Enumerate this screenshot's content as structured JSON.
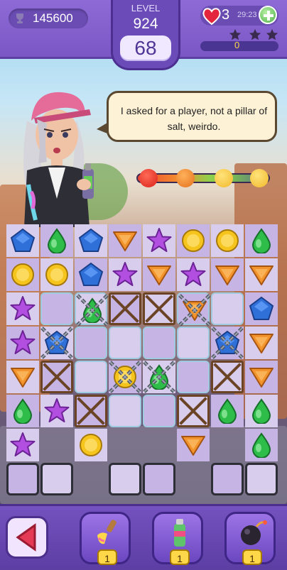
{
  "header": {
    "score": "145600",
    "level_label": "LEVEL",
    "level_number": "924",
    "moves_left": "68",
    "lives": "3",
    "lives_timer": "29:23",
    "star_progress": "0",
    "stars_earned": 0,
    "stars_total": 3
  },
  "character": {
    "speech": "I asked for a player, not a pillar of salt, weirdo.",
    "mood_faces": [
      "angry-face-icon",
      "annoyed-face-icon",
      "neutral-face-icon",
      "happy-face-icon"
    ]
  },
  "board": {
    "rows": [
      [
        "blue-pentagon",
        "green-drop",
        "blue-pentagon",
        "orange-triangle",
        "purple-star",
        "yellow-circle",
        "yellow-circle",
        "green-drop"
      ],
      [
        "yellow-circle",
        "yellow-circle",
        "blue-pentagon",
        "purple-star",
        "orange-triangle",
        "purple-star",
        "orange-triangle",
        "orange-triangle"
      ],
      [
        "purple-star",
        "ice",
        "chained-green-drop-ice",
        "crate",
        "crate",
        "chained-orange-triangle-ice",
        "ice",
        "blue-pentagon"
      ],
      [
        "purple-star",
        "chained-blue-pentagon",
        "ice",
        "ice",
        "ice",
        "ice",
        "chained-blue-pentagon",
        "orange-triangle"
      ],
      [
        "orange-triangle",
        "crate",
        "ice",
        "chained-yellow-circle",
        "chained-green-drop",
        "ice",
        "crate",
        "orange-triangle"
      ],
      [
        "green-drop",
        "purple-star",
        "crate",
        "ice",
        "ice",
        "crate",
        "green-drop",
        "green-drop"
      ],
      [
        "purple-star",
        "empty",
        "yellow-circle",
        "empty",
        "empty",
        "orange-triangle",
        "empty",
        "green-drop"
      ],
      [
        "grate",
        "grate",
        "empty",
        "grate",
        "grate",
        "empty",
        "grate",
        "grate"
      ]
    ]
  },
  "toolbar": {
    "back_label": "back",
    "boosters": [
      {
        "name": "paintbrush-booster-icon",
        "count": "1"
      },
      {
        "name": "spray-can-booster-icon",
        "count": "1"
      },
      {
        "name": "bomb-booster-icon",
        "count": "1"
      }
    ]
  },
  "colors": {
    "blue": "#2f6fd8",
    "green": "#2fbd4a",
    "orange": "#f3932b",
    "purple": "#b24fe0",
    "yellow": "#f6c51d"
  }
}
